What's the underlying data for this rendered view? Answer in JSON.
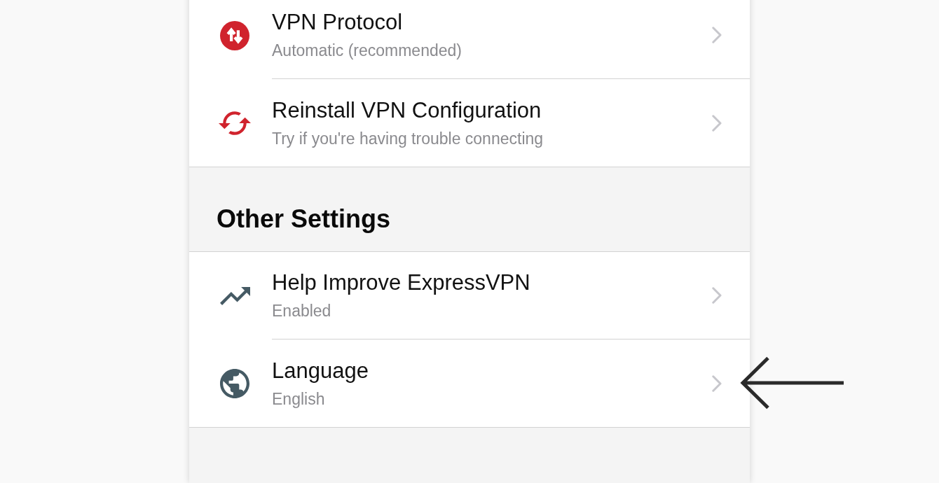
{
  "sections": [
    {
      "items": [
        {
          "kind": "protocol",
          "title": "VPN Protocol",
          "subtitle": "Automatic (recommended)",
          "annotated": false
        },
        {
          "kind": "reinstall",
          "title": "Reinstall VPN Configuration",
          "subtitle": "Try if you're having trouble connecting",
          "annotated": false
        }
      ]
    },
    {
      "title": "Other Settings",
      "items": [
        {
          "kind": "analytics",
          "title": "Help Improve ExpressVPN",
          "subtitle": "Enabled",
          "annotated": false
        },
        {
          "kind": "language",
          "title": "Language",
          "subtitle": "English",
          "annotated": true
        }
      ]
    }
  ]
}
